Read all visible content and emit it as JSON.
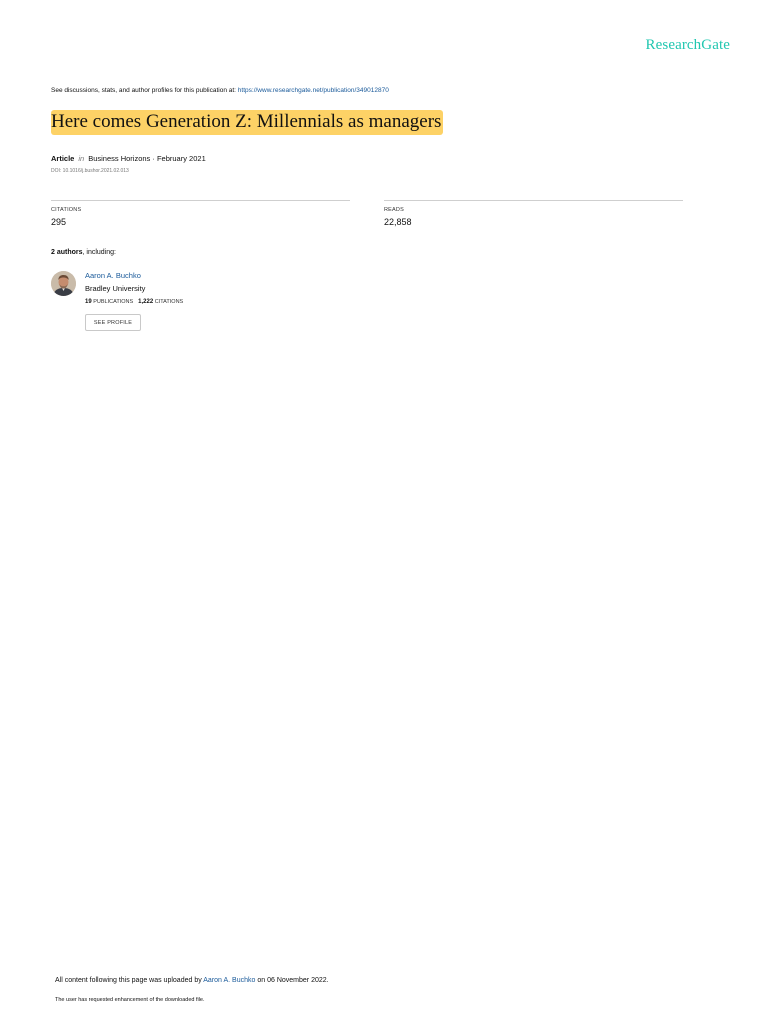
{
  "brand": {
    "logo_text": "ResearchGate",
    "logo_color": "#21c7b0"
  },
  "header": {
    "discussion_prefix": "See discussions, stats, and author profiles for this publication at: ",
    "publication_url": "https://www.researchgate.net/publication/349012870"
  },
  "publication": {
    "title": "Here comes Generation Z: Millennials as managers",
    "type": "Article",
    "in_word": "in",
    "journal_date": "Business Horizons · February 2021",
    "doi": "DOI: 10.1016/j.bushor.2021.02.013"
  },
  "stats": {
    "citations_label": "CITATIONS",
    "citations_value": "295",
    "reads_label": "READS",
    "reads_value": "22,858"
  },
  "authors_section": {
    "count_text": "2 authors",
    "suffix": ", including:"
  },
  "author": {
    "name": "Aaron A. Buchko",
    "institution": "Bradley University",
    "publications_count": "19",
    "publications_label": "PUBLICATIONS",
    "citations_count": "1,222",
    "citations_label": "CITATIONS",
    "see_profile_label": "SEE PROFILE"
  },
  "footer": {
    "uploaded_prefix": "All content following this page was uploaded by ",
    "uploaded_author": "Aaron A. Buchko",
    "uploaded_suffix": " on 06 November 2022.",
    "request_text": "The user has requested enhancement of the downloaded file."
  },
  "colors": {
    "highlight": "#fdd266",
    "link": "#1a5a9a"
  }
}
